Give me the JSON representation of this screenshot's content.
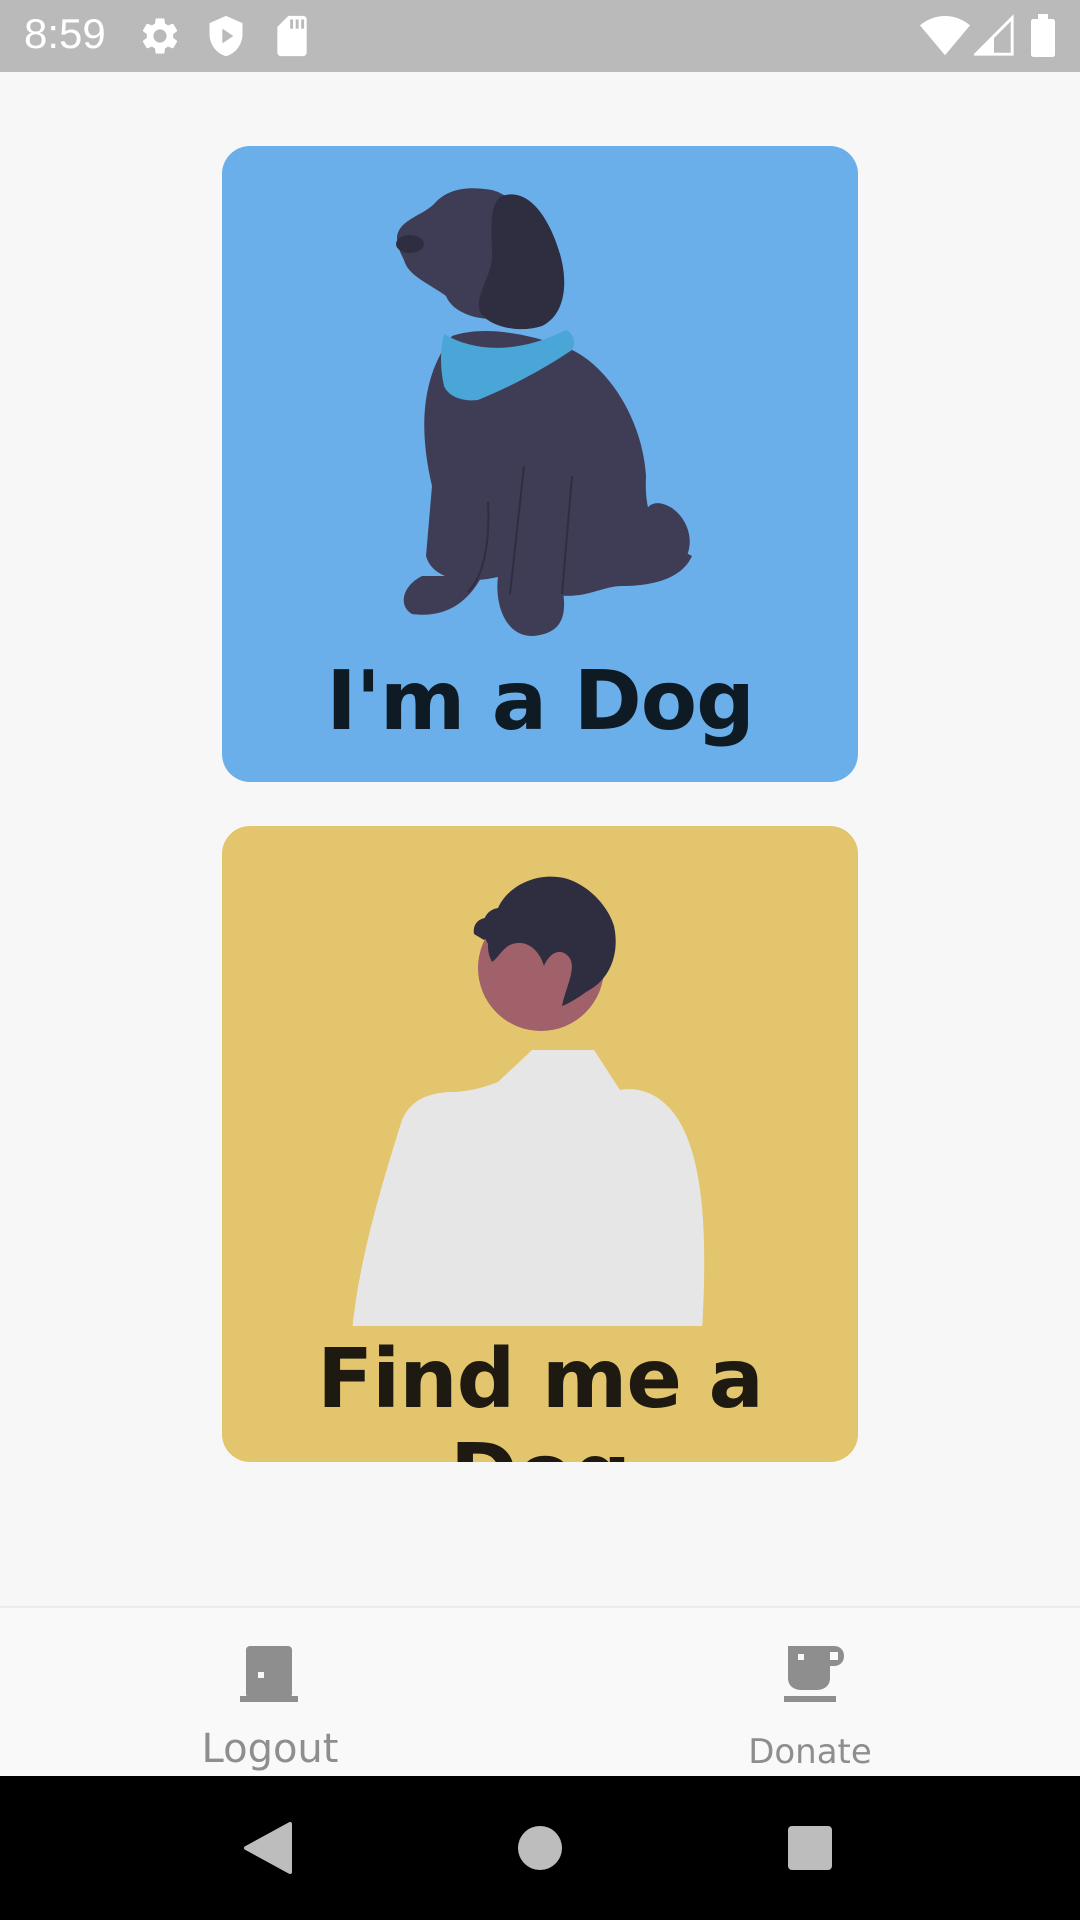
{
  "status_bar": {
    "time": "8:59",
    "icons_left": [
      "gear-icon",
      "shield-play-icon",
      "sd-card-icon"
    ],
    "icons_right": [
      "wifi-icon",
      "signal-icon",
      "battery-icon"
    ]
  },
  "cards": [
    {
      "label": "I'm a Dog",
      "background": "#6aafe9",
      "illustration": "dog-illustration"
    },
    {
      "label": "Find me a Dog",
      "background": "#e3c56d",
      "illustration": "person-illustration"
    }
  ],
  "bottom_nav": {
    "logout_label": "Logout",
    "logout_icon": "door-icon",
    "donate_label": "Donate",
    "donate_icon": "coffee-cup-icon"
  },
  "system_nav": {
    "buttons": [
      "back-icon",
      "home-icon",
      "recents-icon"
    ]
  }
}
